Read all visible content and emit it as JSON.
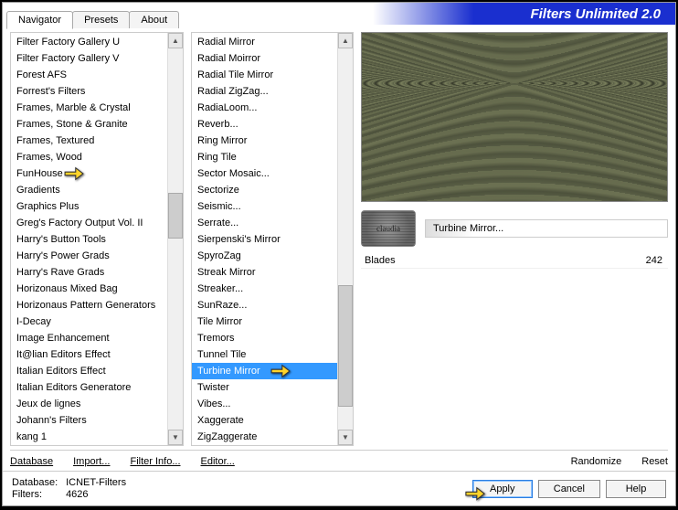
{
  "title": "Filters Unlimited 2.0",
  "tabs": [
    "Navigator",
    "Presets",
    "About"
  ],
  "active_tab": 0,
  "categories": [
    "Filter Factory Gallery U",
    "Filter Factory Gallery V",
    "Forest AFS",
    "Forrest's Filters",
    "Frames, Marble & Crystal",
    "Frames, Stone & Granite",
    "Frames, Textured",
    "Frames, Wood",
    "FunHouse",
    "Gradients",
    "Graphics Plus",
    "Greg's Factory Output Vol. II",
    "Harry's Button Tools",
    "Harry's Power Grads",
    "Harry's Rave Grads",
    "Horizonaus Mixed Bag",
    "Horizonaus Pattern Generators",
    "I-Decay",
    "Image Enhancement",
    "It@lian Editors Effect",
    "Italian Editors Effect",
    "Italian Editors Generatore",
    "Jeux de lignes",
    "Johann's Filters",
    "kang 1"
  ],
  "category_pointer_index": 8,
  "filters": [
    "Radial Mirror",
    "Radial Moirror",
    "Radial Tile Mirror",
    "Radial ZigZag...",
    "RadiaLoom...",
    "Reverb...",
    "Ring Mirror",
    "Ring Tile",
    "Sector Mosaic...",
    "Sectorize",
    "Seismic...",
    "Serrate...",
    "Sierpenski's Mirror",
    "SpyroZag",
    "Streak Mirror",
    "Streaker...",
    "SunRaze...",
    "Tile Mirror",
    "Tremors",
    "Tunnel Tile",
    "Turbine Mirror",
    "Twister",
    "Vibes...",
    "Xaggerate",
    "ZigZaggerate"
  ],
  "filter_selected_index": 20,
  "current_filter": "Turbine Mirror...",
  "badge_text": "claudia",
  "params": [
    {
      "name": "Blades",
      "value": "242"
    }
  ],
  "links": {
    "database": "Database",
    "import": "Import...",
    "filter_info": "Filter Info...",
    "editor": "Editor...",
    "randomize": "Randomize",
    "reset": "Reset"
  },
  "status": {
    "db_label": "Database:",
    "db_value": "ICNET-Filters",
    "filters_label": "Filters:",
    "filters_value": "4626"
  },
  "buttons": {
    "apply": "Apply",
    "cancel": "Cancel",
    "help": "Help"
  }
}
